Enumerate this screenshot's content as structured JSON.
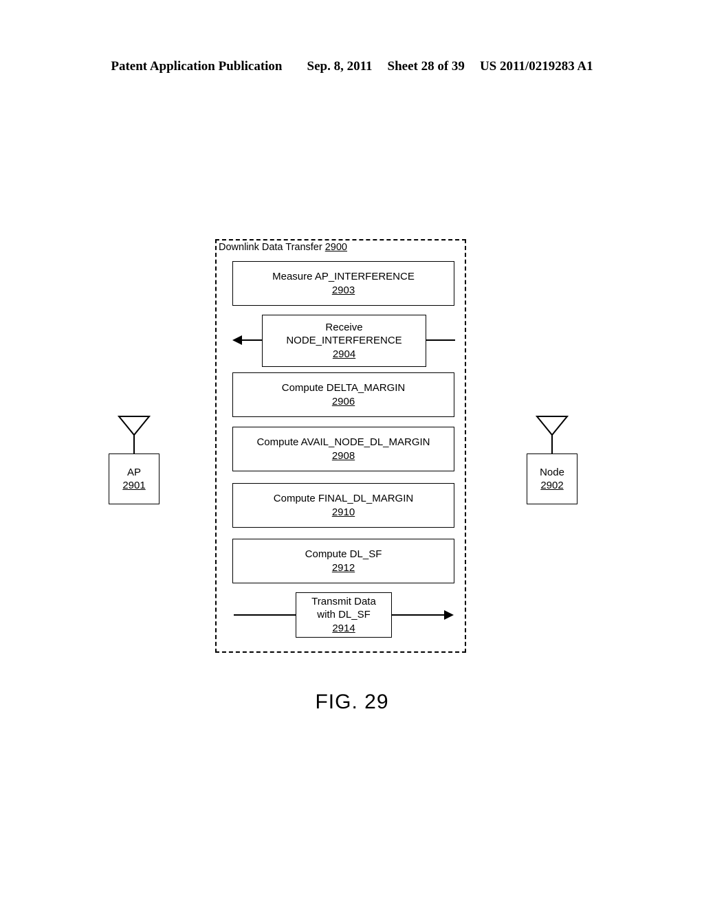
{
  "header": {
    "publication": "Patent Application Publication",
    "date": "Sep. 8, 2011",
    "sheet": "Sheet 28 of 39",
    "patent_number": "US 2011/0219283 A1"
  },
  "figure": {
    "caption": "FIG. 29",
    "container": {
      "title": "Downlink Data Transfer",
      "ref": "2900"
    },
    "steps": [
      {
        "id": "2903",
        "lines": [
          "Measure AP_INTERFERENCE"
        ],
        "ref": "2903"
      },
      {
        "id": "2904",
        "lines": [
          "Receive",
          "NODE_INTERFERENCE"
        ],
        "ref": "2904"
      },
      {
        "id": "2906",
        "lines": [
          "Compute DELTA_MARGIN"
        ],
        "ref": "2906"
      },
      {
        "id": "2908",
        "lines": [
          "Compute AVAIL_NODE_DL_MARGIN"
        ],
        "ref": "2908"
      },
      {
        "id": "2910",
        "lines": [
          "Compute FINAL_DL_MARGIN"
        ],
        "ref": "2910"
      },
      {
        "id": "2912",
        "lines": [
          "Compute DL_SF"
        ],
        "ref": "2912"
      },
      {
        "id": "2914",
        "lines": [
          "Transmit Data",
          "with DL_SF"
        ],
        "ref": "2914"
      }
    ],
    "terminals": [
      {
        "label": "AP",
        "ref": "2901",
        "icon": "antenna-icon"
      },
      {
        "label": "Node",
        "ref": "2902",
        "icon": "antenna-icon"
      }
    ]
  }
}
